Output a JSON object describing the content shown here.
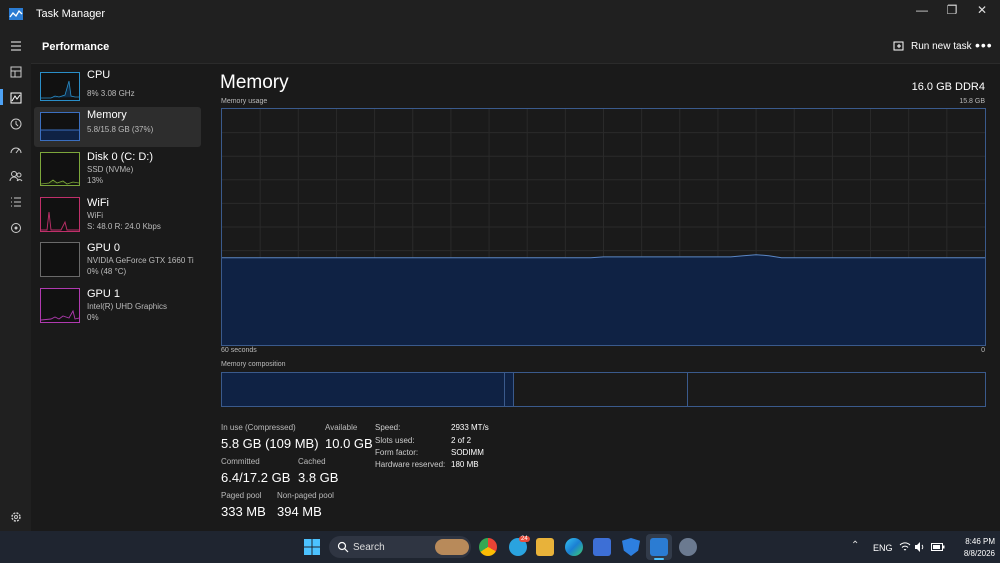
{
  "window": {
    "title": "Task Manager",
    "controls": {
      "minimize": "—",
      "maximize": "❐",
      "close": "✕"
    }
  },
  "header": {
    "section": "Performance",
    "run_new_task": "Run new task",
    "more": "•••"
  },
  "sidebar_items": [
    {
      "title": "CPU",
      "sub1": "8% 3.08 GHz",
      "sub2": "",
      "sub3": "",
      "icon": "cpu-thumbnail",
      "color": "#2a8ec8"
    },
    {
      "title": "Memory",
      "sub1": "5.8/15.8 GB (37%)",
      "sub2": "",
      "sub3": "",
      "icon": "memory-thumbnail",
      "color": "#3b6fc0"
    },
    {
      "title": "Disk 0 (C: D:)",
      "sub1": "SSD (NVMe)",
      "sub2": "13%",
      "sub3": "",
      "icon": "disk-thumbnail",
      "color": "#7ca63b"
    },
    {
      "title": "WiFi",
      "sub1": "WiFi",
      "sub2": "S: 48.0  R: 24.0 Kbps",
      "sub3": "",
      "icon": "wifi-thumbnail",
      "color": "#c0306a"
    },
    {
      "title": "GPU 0",
      "sub1": "NVIDIA GeForce GTX 1660 Ti",
      "sub2": "0%  (48 °C)",
      "sub3": "",
      "icon": "gpu0-thumbnail",
      "color": "#6a6a6a"
    },
    {
      "title": "GPU 1",
      "sub1": "Intel(R) UHD Graphics",
      "sub2": "0%",
      "sub3": "",
      "icon": "gpu1-thumbnail",
      "color": "#b03ab0"
    }
  ],
  "memory": {
    "title": "Memory",
    "total": "16.0 GB DDR4",
    "usage_label": "Memory usage",
    "usage_max": "15.8 GB",
    "x_left": "60 seconds",
    "x_right": "0",
    "composition_label": "Memory composition",
    "usage_fraction": 0.37,
    "stats": {
      "in_use_label": "In use (Compressed)",
      "in_use": "5.8 GB (109 MB)",
      "available_label": "Available",
      "available": "10.0 GB",
      "committed_label": "Committed",
      "committed": "6.4/17.2 GB",
      "cached_label": "Cached",
      "cached": "3.8 GB",
      "paged_label": "Paged pool",
      "paged": "333 MB",
      "nonpaged_label": "Non-paged pool",
      "nonpaged": "394 MB"
    },
    "details": [
      {
        "label": "Speed:",
        "value": "2933 MT/s"
      },
      {
        "label": "Slots used:",
        "value": "2 of 2"
      },
      {
        "label": "Form factor:",
        "value": "SODIMM"
      },
      {
        "label": "Hardware reserved:",
        "value": "180 MB"
      }
    ]
  },
  "taskbar": {
    "search": "Search",
    "language": "ENG",
    "time": "8:46 PM",
    "date": "8/8/2026",
    "badge": "24"
  },
  "colors": {
    "graph_line": "#5a86c5",
    "graph_fill": "#0f2244",
    "grid": "#2a2a2a",
    "accent": "#3a5a8c"
  }
}
